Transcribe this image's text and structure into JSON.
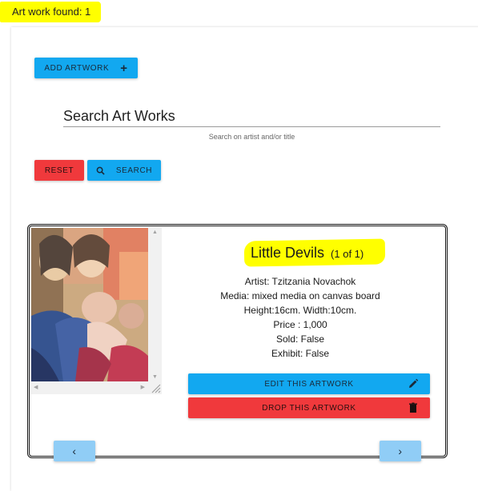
{
  "banner": {
    "found_text": "Art work found: 1"
  },
  "toolbar": {
    "add_label": "ADD ARTWORK",
    "add_icon": "plus-icon"
  },
  "search": {
    "placeholder": "Search Art Works",
    "hint": "Search on artist and/or title",
    "reset_label": "RESET",
    "search_label": "SEARCH",
    "search_icon": "search-icon"
  },
  "artwork": {
    "title": "Little Devils",
    "counter": "(1 of 1)",
    "artist": "Artist: Tzitzania Novachok",
    "media": "Media: mixed media on canvas board",
    "dimensions": "Height:16cm. Width:10cm.",
    "price": "Price : 1,000",
    "sold": "Sold: False",
    "exhibit": "Exhibit: False",
    "edit_label": "EDIT THIS ARTWORK",
    "edit_icon": "pencil-icon",
    "drop_label": "DROP THIS ARTWORK",
    "drop_icon": "trash-icon"
  },
  "pager": {
    "prev": "‹",
    "next": "›"
  },
  "colors": {
    "highlight": "#ffff00",
    "primary": "#12a8f0",
    "danger": "#f0393c",
    "pager": "#90cdf6"
  }
}
